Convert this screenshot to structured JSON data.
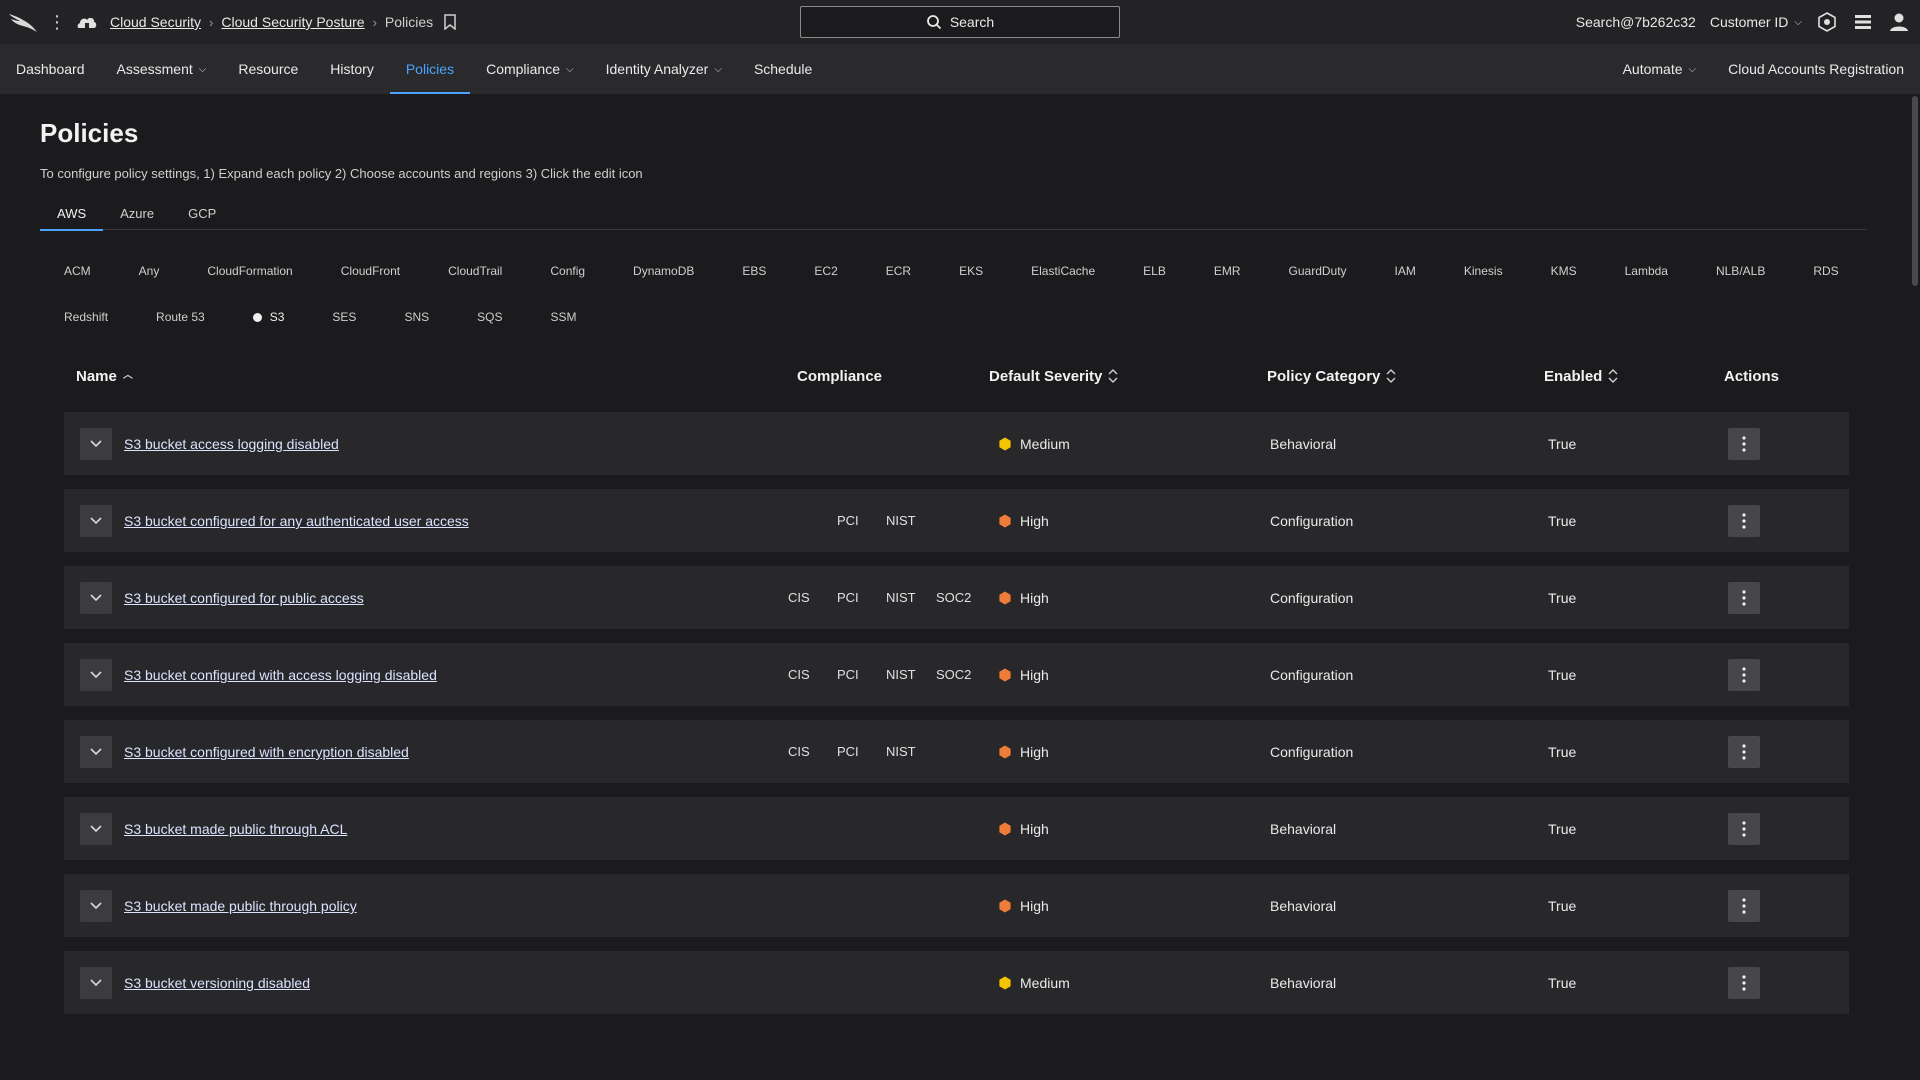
{
  "topbar": {
    "breadcrumbs": [
      {
        "label": "Cloud Security",
        "link": true
      },
      {
        "label": "Cloud Security Posture",
        "link": true
      },
      {
        "label": "Policies",
        "link": false
      }
    ],
    "search_label": "Search",
    "user_label": "Search@7b262c32",
    "customer_label": "Customer ID",
    "icons": [
      "falcon-logo-icon",
      "kebab-menu-icon",
      "cloud-home-icon",
      "bookmark-icon",
      "search-icon",
      "hexagon-settings-icon",
      "stack-icon",
      "user-icon"
    ]
  },
  "nav": {
    "items": [
      {
        "label": "Dashboard",
        "dropdown": false,
        "active": false
      },
      {
        "label": "Assessment",
        "dropdown": true,
        "active": false
      },
      {
        "label": "Resource",
        "dropdown": false,
        "active": false
      },
      {
        "label": "History",
        "dropdown": false,
        "active": false
      },
      {
        "label": "Policies",
        "dropdown": false,
        "active": true
      },
      {
        "label": "Compliance",
        "dropdown": true,
        "active": false
      },
      {
        "label": "Identity Analyzer",
        "dropdown": true,
        "active": false
      },
      {
        "label": "Schedule",
        "dropdown": false,
        "active": false
      }
    ],
    "right_items": [
      {
        "label": "Automate",
        "dropdown": true
      },
      {
        "label": "Cloud Accounts Registration",
        "dropdown": false
      }
    ]
  },
  "page": {
    "title": "Policies",
    "instructions": "To configure policy settings, 1) Expand each policy 2) Choose accounts and regions 3) Click the edit icon"
  },
  "cloud_tabs": [
    {
      "label": "AWS",
      "active": true
    },
    {
      "label": "Azure",
      "active": false
    },
    {
      "label": "GCP",
      "active": false
    }
  ],
  "services": {
    "row1": [
      "ACM",
      "Any",
      "CloudFormation",
      "CloudFront",
      "CloudTrail",
      "Config",
      "DynamoDB",
      "EBS",
      "EC2",
      "ECR",
      "EKS",
      "ElastiCache",
      "ELB",
      "EMR",
      "GuardDuty",
      "IAM",
      "Kinesis",
      "KMS",
      "Lambda",
      "NLB/ALB",
      "RDS"
    ],
    "row2": [
      "Redshift",
      "Route 53",
      "S3",
      "SES",
      "SNS",
      "SQS",
      "SSM"
    ],
    "selected": "S3"
  },
  "table": {
    "headers": {
      "name": "Name",
      "compliance": "Compliance",
      "severity": "Default Severity",
      "category": "Policy Category",
      "enabled": "Enabled",
      "actions": "Actions"
    },
    "severity_colors": {
      "Medium": "#f5c400",
      "High": "#f07c3a"
    },
    "rows": [
      {
        "name": "S3 bucket access logging disabled",
        "compliance": {
          "CIS": false,
          "PCI": false,
          "NIST": false,
          "SOC2": false
        },
        "severity": "Medium",
        "category": "Behavioral",
        "enabled": "True"
      },
      {
        "name": "S3 bucket configured for any authenticated user access",
        "compliance": {
          "CIS": false,
          "PCI": true,
          "NIST": true,
          "SOC2": false
        },
        "severity": "High",
        "category": "Configuration",
        "enabled": "True"
      },
      {
        "name": "S3 bucket configured for public access",
        "compliance": {
          "CIS": true,
          "PCI": true,
          "NIST": true,
          "SOC2": true
        },
        "severity": "High",
        "category": "Configuration",
        "enabled": "True"
      },
      {
        "name": "S3 bucket configured with access logging disabled",
        "compliance": {
          "CIS": true,
          "PCI": true,
          "NIST": true,
          "SOC2": true
        },
        "severity": "High",
        "category": "Configuration",
        "enabled": "True"
      },
      {
        "name": "S3 bucket configured with encryption disabled",
        "compliance": {
          "CIS": true,
          "PCI": true,
          "NIST": true,
          "SOC2": false
        },
        "severity": "High",
        "category": "Configuration",
        "enabled": "True"
      },
      {
        "name": "S3 bucket made public through ACL",
        "compliance": {
          "CIS": false,
          "PCI": false,
          "NIST": false,
          "SOC2": false
        },
        "severity": "High",
        "category": "Behavioral",
        "enabled": "True"
      },
      {
        "name": "S3 bucket made public through policy",
        "compliance": {
          "CIS": false,
          "PCI": false,
          "NIST": false,
          "SOC2": false
        },
        "severity": "High",
        "category": "Behavioral",
        "enabled": "True"
      },
      {
        "name": "S3 bucket versioning disabled",
        "compliance": {
          "CIS": false,
          "PCI": false,
          "NIST": false,
          "SOC2": false
        },
        "severity": "Medium",
        "category": "Behavioral",
        "enabled": "True"
      }
    ]
  }
}
